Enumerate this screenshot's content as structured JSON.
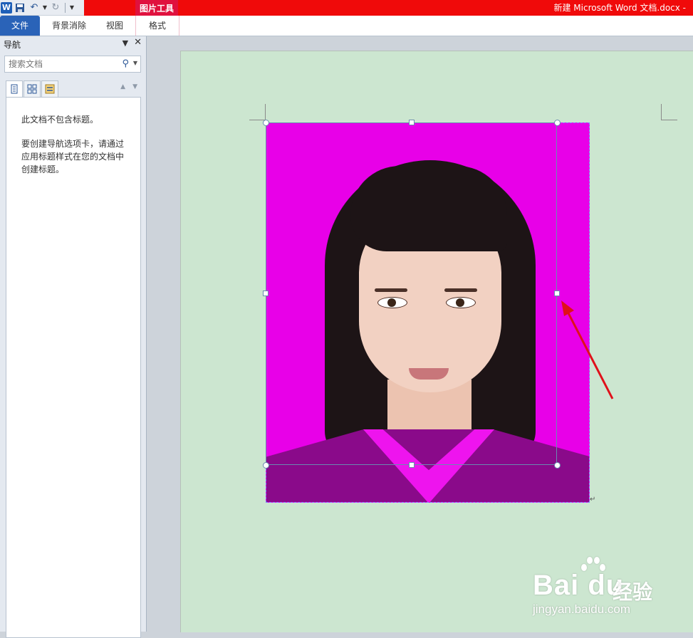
{
  "titlebar": {
    "tool_tab_group": "图片工具",
    "document_title": "新建 Microsoft Word 文档.docx -"
  },
  "ribbon": {
    "tabs": [
      {
        "label": "文件"
      },
      {
        "label": "背景消除"
      },
      {
        "label": "视图"
      },
      {
        "label": "格式"
      }
    ]
  },
  "nav_pane": {
    "title": "导航",
    "search_placeholder": "搜索文档",
    "empty_message_1": "此文档不包含标题。",
    "empty_message_2": "要创建导航选项卡，请通过应用标题样式在您的文档中创建标题。"
  },
  "watermark": {
    "brand": "Bai du",
    "brand_cn": "经验",
    "url": "jingyan.baidu.com"
  },
  "colors": {
    "title_bar": "#f00a0a",
    "tool_tab": "#e0113e",
    "file_tab": "#2a63b8",
    "page": "#cce6d0",
    "photo_background": "#e800e8",
    "arrow": "#e0101a"
  },
  "icons": [
    "word-logo-icon",
    "save-icon",
    "undo-icon",
    "redo-icon",
    "customize-qat-icon",
    "search-icon",
    "headings-view-icon",
    "pages-view-icon",
    "results-view-icon",
    "previous-arrow-icon",
    "next-arrow-icon",
    "close-icon"
  ]
}
